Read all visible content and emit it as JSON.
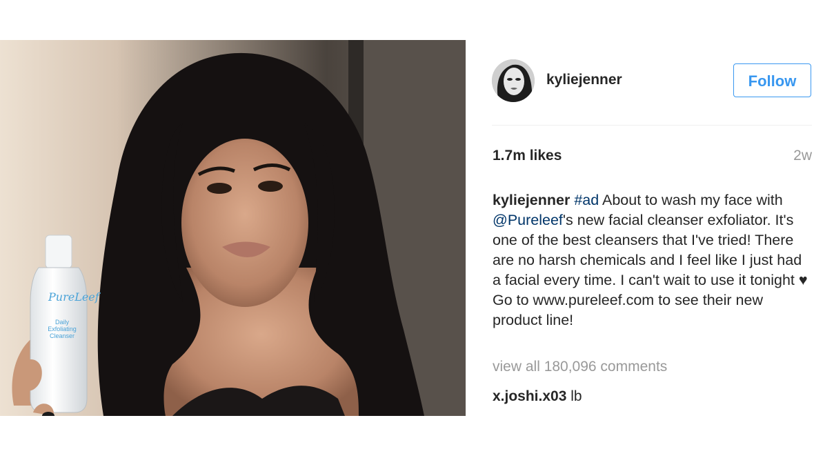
{
  "post": {
    "photo": {
      "product_brand": "PureLeef",
      "product_name_line1": "Daily",
      "product_name_line2": "Exfoliating",
      "product_name_line3": "Cleanser"
    },
    "header": {
      "username": "kyliejenner",
      "follow_label": "Follow"
    },
    "stats": {
      "likes": "1.7m likes",
      "age": "2w"
    },
    "caption": {
      "username": "kyliejenner",
      "hashtag": "#ad",
      "text_1": " About to wash my face with ",
      "mention": "@Pureleef",
      "text_2": "'s new facial cleanser exfoliator. It's one of the best cleansers that I've tried! There are no harsh chemicals and I feel like I just had a facial every time. I can't wait to use it tonight ♥ Go to www.pureleef.com to see their new product line!"
    },
    "view_all_comments": "view all 180,096 comments",
    "comment": {
      "username": "x.joshi.x03",
      "text": "lb"
    },
    "colors": {
      "accent": "#3897f0",
      "link": "#003569",
      "muted": "#999999",
      "text": "#262626"
    }
  }
}
